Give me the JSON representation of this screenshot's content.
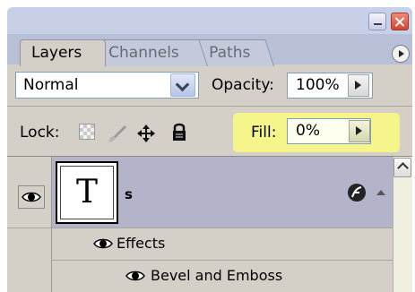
{
  "tabs": [
    {
      "label": "Layers",
      "active": true
    },
    {
      "label": "Channels",
      "active": false
    },
    {
      "label": "Paths",
      "active": false
    }
  ],
  "blend_mode": {
    "selected": "Normal"
  },
  "opacity": {
    "label": "Opacity:",
    "value": "100%"
  },
  "lock": {
    "label": "Lock:",
    "icons": [
      "lock-transparent-pixels-icon",
      "lock-image-pixels-icon",
      "lock-position-icon",
      "lock-all-icon"
    ]
  },
  "fill": {
    "label": "Fill:",
    "value": "0%",
    "highlight_color": "#f5f58c"
  },
  "layers": [
    {
      "thumbnail_letter": "T",
      "name": "s",
      "visible": true,
      "selected": true,
      "has_effects": true
    }
  ],
  "effects": {
    "label": "Effects",
    "items": [
      "Bevel and Emboss"
    ]
  },
  "colors": {
    "selected_row": "#b3b3c9",
    "panel_bg": "#d4d0c8",
    "tab_strip": "#b8c0d8"
  }
}
